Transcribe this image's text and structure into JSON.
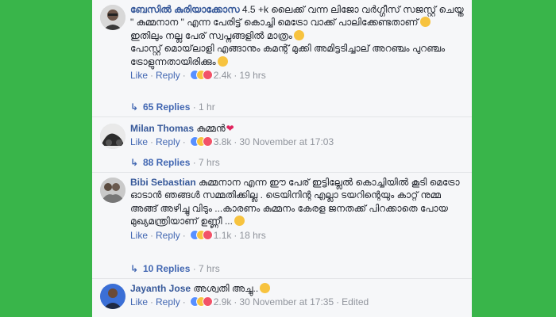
{
  "comments": [
    {
      "name": "ബേസിൽ കുരിയാക്കോസ",
      "text": " 4.5 +k ലൈക്ക് വന്ന ലിജോ വർഗ്ഗീസ് സജസ്റ്റ് ചെയ്ത \" കുമ്മനാന \" എന്ന പേരിട്ട് കൊച്ചി മെട്രോ വാക്ക് പാലിക്കേണ്ടതാണ്",
      "text2": "ഇതിലും നല്ല പേര് സ്വപ്നങ്ങളിൽ മാത്രം",
      "text3": "പോസ്റ്റ് മൊയ്‌ലാളി എങ്ങാനും കമന്റ് മുക്കി അമിട്ടടിച്ചാല് അറഞ്ചം പുറഞ്ചം ട്രോളുന്നതായിരിക്കും",
      "like": "Like",
      "reply": "Reply",
      "count": "2.4k",
      "time": "19 hrs",
      "replies": "65 Replies",
      "replies_time": "1 hr"
    },
    {
      "name": "Milan Thomas",
      "text": " കുമ്മൻ",
      "like": "Like",
      "reply": "Reply",
      "count": "3.8k",
      "time": "30 November at 17:03",
      "replies": "88 Replies",
      "replies_time": "7 hrs"
    },
    {
      "name": "Bibi Sebastian",
      "text": " കുമ്മനാന എന്ന ഈ പേര് ഇട്ടില്ലേൽ കൊച്ചിയിൽ കൂടി മെട്രോ ഓടാൻ ഞങ്ങൾ സമ്മതിക്കില്ല . ട്രെയിനിന്റ എല്ലാ ടയറിന്റെയും കാറ്റ് നുമ്മ അങ്ങ് അഴിച്ചു വിടും ...കാരണം കുമ്മനം കേരള ജനതക്ക് പിറക്കാതെ പോയ മുഖ്യമന്ത്രിയാണ് ഉണ്ണീ ...",
      "like": "Like",
      "reply": "Reply",
      "count": "1.1k",
      "time": "18 hrs",
      "replies": "10 Replies",
      "replies_time": "7 hrs"
    },
    {
      "name": "Jayanth Jose",
      "text": " അശ്വതി അച്ചു..",
      "like": "Like",
      "reply": "Reply",
      "count": "2.9k",
      "time": "30 November at 17:35",
      "edited": "Edited"
    }
  ],
  "colors": {
    "background": "#39b54a",
    "link": "#365899",
    "action": "#4267b2",
    "meta": "#90949c",
    "like_blue": "#5890ff",
    "haha_yellow": "#f7c33f",
    "love_red": "#f25268"
  }
}
